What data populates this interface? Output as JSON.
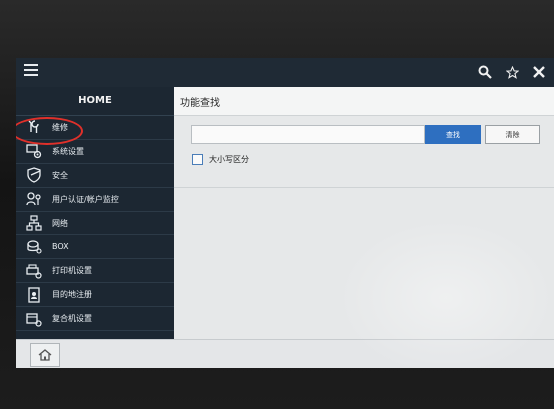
{
  "sidebar": {
    "home_label": "HOME",
    "items": [
      {
        "label": "维修",
        "icon": "wrench-screwdriver-icon"
      },
      {
        "label": "系统设置",
        "icon": "system-settings-icon"
      },
      {
        "label": "安全",
        "icon": "shield-icon"
      },
      {
        "label": "用户认证/帐户监控",
        "icon": "user-key-icon"
      },
      {
        "label": "网络",
        "icon": "network-icon"
      },
      {
        "label": "BOX",
        "icon": "box-icon"
      },
      {
        "label": "打印机设置",
        "icon": "printer-settings-icon"
      },
      {
        "label": "目的地注册",
        "icon": "address-book-icon"
      },
      {
        "label": "复合机设置",
        "icon": "mfp-settings-icon"
      }
    ]
  },
  "main": {
    "title": "功能查找",
    "search": {
      "value": "",
      "button_label": "查找",
      "clear_label": "清除"
    },
    "case_sensitive_label": "大小写区分",
    "case_sensitive_checked": false
  },
  "colors": {
    "topbar": "#1f2a35",
    "sidebar": "#1c2732",
    "accent_blue": "#2e6fc0",
    "highlight_red": "#e0302a"
  }
}
